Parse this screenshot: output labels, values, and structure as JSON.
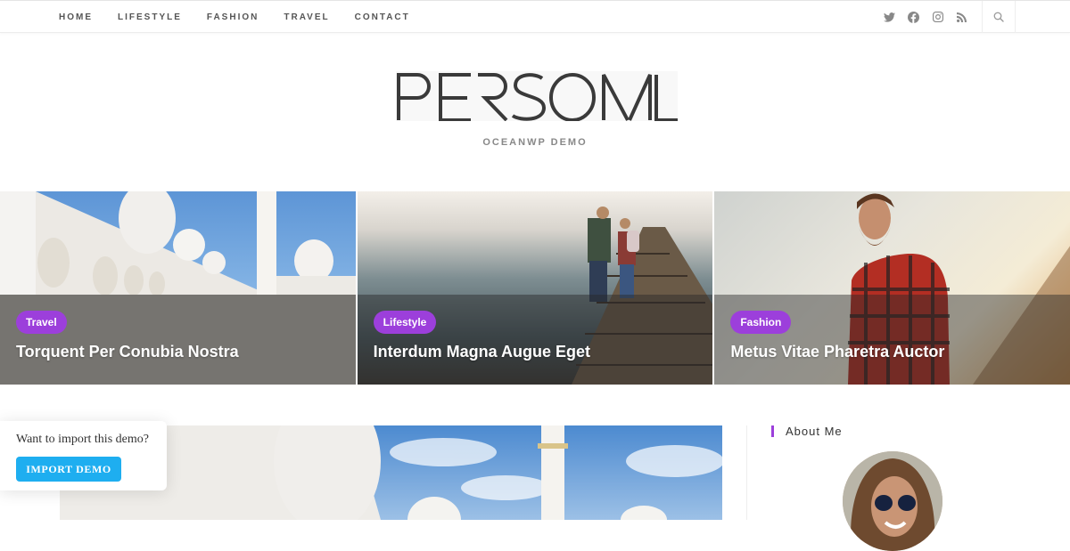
{
  "nav": {
    "items": [
      {
        "label": "HOME"
      },
      {
        "label": "LIFESTYLE"
      },
      {
        "label": "FASHION"
      },
      {
        "label": "TRAVEL"
      },
      {
        "label": "CONTACT"
      }
    ],
    "social": [
      "twitter-icon",
      "facebook-icon",
      "instagram-icon",
      "rss-icon"
    ],
    "search_icon": "search-icon"
  },
  "header": {
    "logo_text": "PERSONAL",
    "tagline": "OCEANWP DEMO"
  },
  "featured": [
    {
      "category": "Travel",
      "title": "Torquent Per Conubia Nostra",
      "image": "mosque"
    },
    {
      "category": "Lifestyle",
      "title": "Interdum Magna Augue Eget",
      "image": "railway-bridge-walkers"
    },
    {
      "category": "Fashion",
      "title": "Metus Vitae Pharetra Auctor",
      "image": "bearded-man-plaid-shirt"
    }
  ],
  "sidebar": {
    "widget_title": "About Me"
  },
  "popup": {
    "question": "Want to import this demo?",
    "button_label": "IMPORT DEMO"
  },
  "colors": {
    "accent": "#9c3fdb",
    "import_button": "#1eaef0",
    "nav_text": "#555555"
  }
}
